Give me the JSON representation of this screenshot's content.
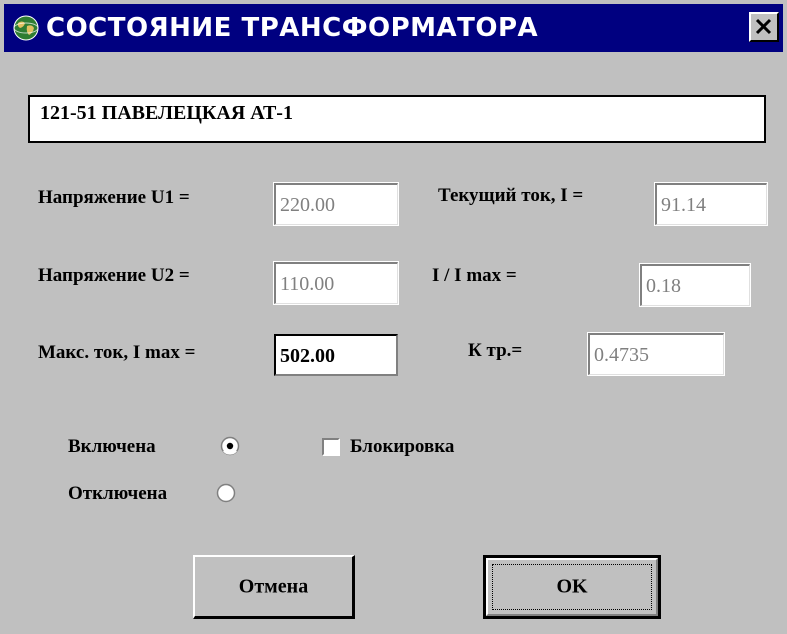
{
  "window": {
    "title": "СОСТОЯНИЕ ТРАНСФОРМАТОРА",
    "icon": "globe-icon",
    "close_icon": "close-icon"
  },
  "transformer_name": "121-51 ПАВЕЛЕЦКАЯ АТ-1",
  "fields": {
    "u1_label": "Напряжение U1 =",
    "u1_value": "220.00",
    "u2_label": "Напряжение U2 =",
    "u2_value": "110.00",
    "imax_label": "Макс. ток, I max =",
    "imax_value": "502.00",
    "current_label": "Текущий ток,   I =",
    "current_value": "91.14",
    "ratio_label": "I / I max =",
    "ratio_value": "0.18",
    "ktr_label": "К тр.=",
    "ktr_value": "0.4735"
  },
  "state": {
    "on_label": "Включена",
    "on_selected": true,
    "off_label": "Отключена",
    "off_selected": false,
    "lock_label": "Блокировка",
    "lock_checked": false
  },
  "buttons": {
    "cancel_label": "Отмена",
    "ok_label": "OK"
  },
  "colors": {
    "titlebar": "#000080",
    "face": "#c0c0c0",
    "disabled_text": "#808080"
  }
}
